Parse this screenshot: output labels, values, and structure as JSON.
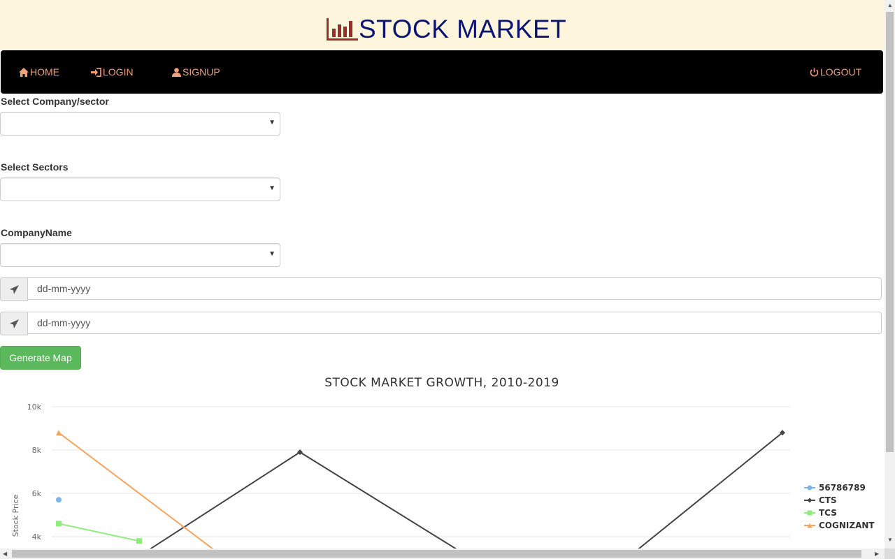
{
  "header": {
    "title": "STOCK MARKET",
    "logo_icon": "bar-chart-icon"
  },
  "nav": {
    "home": "HOME",
    "login": "LOGIN",
    "signup": "SIGNUP",
    "logout": "LOGOUT"
  },
  "form": {
    "company_sector_label": "Select Company/sector",
    "sectors_label": "Select Sectors",
    "company_name_label": "CompanyName",
    "from_date_placeholder": "dd-mm-yyyy",
    "to_date_placeholder": "dd-mm-yyyy",
    "generate_button": "Generate Map"
  },
  "colors": {
    "header_bg": "#fdf6dc",
    "brand_text": "#0b1473",
    "nav_bg": "#000000",
    "nav_text": "#f0a07a",
    "button_bg": "#5cb85c"
  },
  "chart_data": {
    "type": "line",
    "title": "STOCK MARKET GROWTH, 2010-2019",
    "ylabel": "Stock Price",
    "y_ticks": [
      "10k",
      "8k",
      "6k",
      "4k"
    ],
    "ylim": [
      4000,
      10000
    ],
    "legend_position": "right",
    "series": [
      {
        "name": "56786789",
        "color": "#7cb5ec",
        "marker": "circle",
        "points": [
          {
            "x": 0,
            "y": 5700
          }
        ]
      },
      {
        "name": "CTS",
        "color": "#434348",
        "marker": "diamond",
        "points": [
          {
            "x": 1,
            "y": 3100
          },
          {
            "x": 3,
            "y": 7900
          },
          {
            "x": 5,
            "y": 3300
          },
          {
            "x": 7,
            "y": 2800
          },
          {
            "x": 9,
            "y": 8800
          }
        ]
      },
      {
        "name": "TCS",
        "color": "#90ed7d",
        "marker": "square",
        "points": [
          {
            "x": 0,
            "y": 4600
          },
          {
            "x": 1,
            "y": 3800
          }
        ]
      },
      {
        "name": "COGNIZANT",
        "color": "#f7a35c",
        "marker": "triangle",
        "points": [
          {
            "x": 0,
            "y": 8800
          },
          {
            "x": 2,
            "y": 3200
          }
        ]
      }
    ]
  }
}
